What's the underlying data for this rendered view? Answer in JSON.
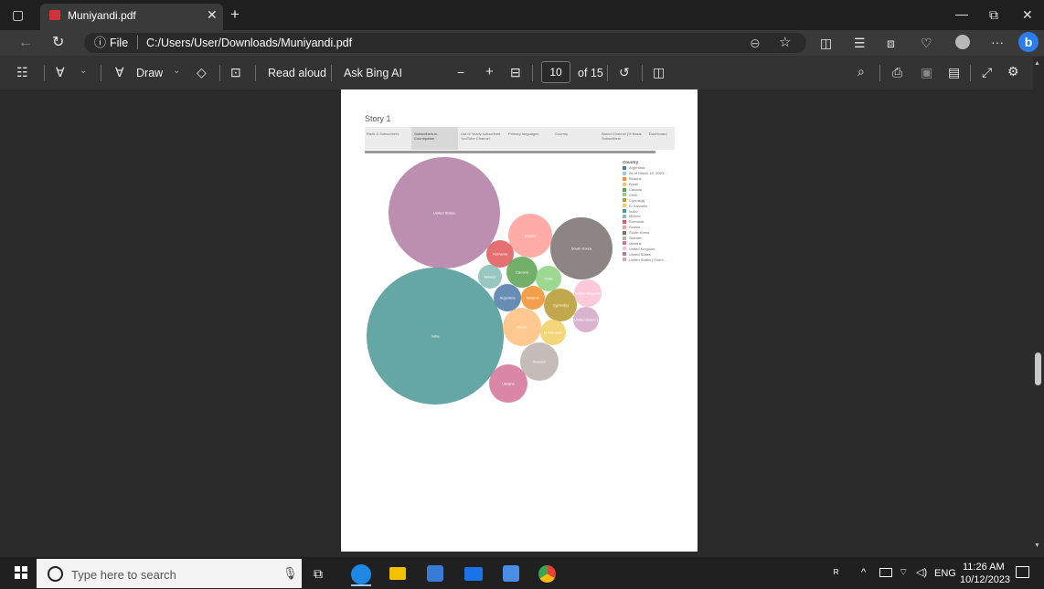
{
  "browser": {
    "tab_title": "Muniyandi.pdf",
    "url_label": "File",
    "url": "C:/Users/User/Downloads/Muniyandi.pdf"
  },
  "toolbar": {
    "draw_label": "Draw",
    "read_aloud_label": "Read aloud",
    "ask_bing_label": "Ask Bing AI",
    "current_page": "10",
    "page_total": "of 15"
  },
  "document": {
    "story_title": "Story 1",
    "story_tabs": [
      "Rank & Subscribers",
      "Subscribers in Countrywise",
      "List of Yearly subscribed YouTube Channel",
      "Primary languages",
      "Country",
      "Brand Channel (% Basis Subscribers",
      "Dashboard"
    ],
    "active_tab_index": 1
  },
  "chart_data": {
    "type": "bubble",
    "legend_title": "Country",
    "legend_position": "top-right",
    "legend": [
      {
        "label": "Argentina",
        "color": "#4e79a7"
      },
      {
        "label": "As of March 16, 2023…",
        "color": "#a0cbe8"
      },
      {
        "label": "Belarus",
        "color": "#f28e2b"
      },
      {
        "label": "Brazil",
        "color": "#ffbe7d"
      },
      {
        "label": "Canada",
        "color": "#59a14f"
      },
      {
        "label": "Chile",
        "color": "#8cd17d"
      },
      {
        "label": "Cyprus[a]",
        "color": "#b6992d"
      },
      {
        "label": "El Salvador",
        "color": "#f1ce63"
      },
      {
        "label": "India",
        "color": "#499894"
      },
      {
        "label": "Mexico",
        "color": "#86bcb6"
      },
      {
        "label": "Romania",
        "color": "#e15759"
      },
      {
        "label": "Russia",
        "color": "#ff9d9a"
      },
      {
        "label": "South Korea",
        "color": "#79706e"
      },
      {
        "label": "Sweden",
        "color": "#bab0ac"
      },
      {
        "label": "Ukraine",
        "color": "#d37295"
      },
      {
        "label": "United Kingdom",
        "color": "#fabfd2"
      },
      {
        "label": "United States",
        "color": "#b07aa1"
      },
      {
        "label": "United States [ Event…",
        "color": "#d4a6c8"
      }
    ],
    "bubbles": [
      {
        "label": "United States",
        "color": "#b07aa1"
      },
      {
        "label": "India",
        "color": "#499894"
      },
      {
        "label": "South Korea",
        "color": "#79706e"
      },
      {
        "label": "Russia",
        "color": "#ff9d9a"
      },
      {
        "label": "Romania",
        "color": "#e15759"
      },
      {
        "label": "Canada",
        "color": "#59a14f"
      },
      {
        "label": "Mexico",
        "color": "#86bcb6"
      },
      {
        "label": "Chile",
        "color": "#8cd17d"
      },
      {
        "label": "Argentina",
        "color": "#4e79a7"
      },
      {
        "label": "Belarus",
        "color": "#f28e2b"
      },
      {
        "label": "Cyprus[a]",
        "color": "#b6992d"
      },
      {
        "label": "United Kingdom",
        "color": "#fabfd2"
      },
      {
        "label": "United States [",
        "color": "#d4a6c8"
      },
      {
        "label": "Brazil",
        "color": "#ffbe7d"
      },
      {
        "label": "El Salvador",
        "color": "#f1ce63"
      },
      {
        "label": "Sweden",
        "color": "#bab0ac"
      },
      {
        "label": "Ukraine",
        "color": "#d37295"
      }
    ]
  },
  "taskbar": {
    "search_placeholder": "Type here to search",
    "language": "ENG",
    "time": "11:26 AM",
    "date": "10/12/2023"
  }
}
